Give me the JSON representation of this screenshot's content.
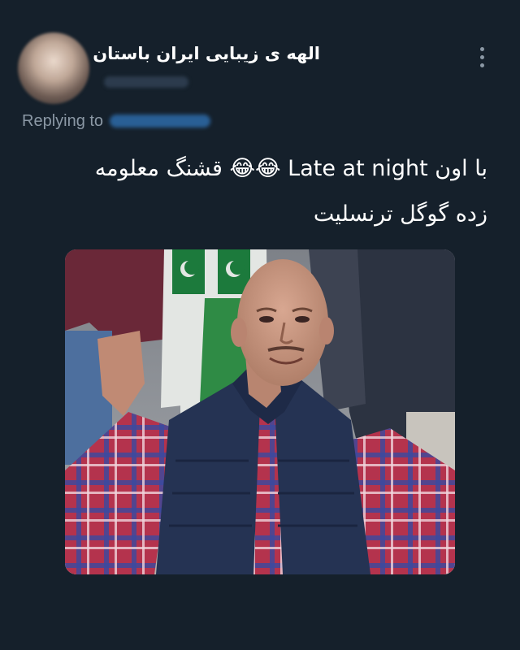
{
  "tweet": {
    "display_name": "الهه ی زیبایی ایران باستان",
    "reply_label": "Replying to",
    "text_line_1": "با اون Late at night 😂😂 قشنگ معلومه",
    "text_line_2": "زده گوگل ترنسلیت"
  },
  "icons": {
    "more": "more-vertical-icon",
    "avatar": "avatar"
  },
  "colors": {
    "background": "#15202b",
    "secondary_text": "#8b98a5",
    "primary_text": "#ffffff"
  }
}
